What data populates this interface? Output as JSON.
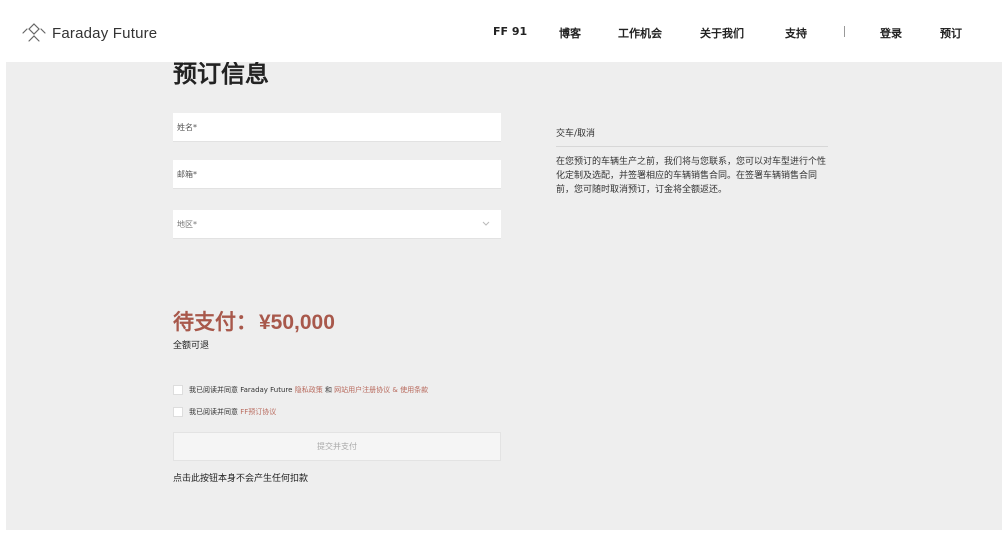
{
  "header": {
    "brand": "Faraday Future",
    "nav": {
      "ff91": "FF 91",
      "blog": "博客",
      "jobs": "工作机会",
      "about": "关于我们",
      "support": "支持",
      "login": "登录",
      "reserve": "预订"
    }
  },
  "form": {
    "title": "预订信息",
    "name_placeholder": "姓名*",
    "email_placeholder": "邮箱*",
    "region_label": "地区*"
  },
  "side": {
    "heading": "交车/取消",
    "body": "在您预订的车辆生产之前，我们将与您联系，您可以对车型进行个性化定制及选配，并签署相应的车辆销售合同。在签署车辆销售合同前，您可随时取消预订，订金将全额返还。"
  },
  "payment": {
    "label": "待支付：",
    "amount": "¥50,000",
    "refund_note": "全额可退"
  },
  "agreements": {
    "line1_prefix": "我已阅读并同意 Faraday Future",
    "line1_privacy": "隐私政策",
    "line1_and": "和",
    "line1_terms": "网站用户注册协议 & 使用条款",
    "line2_prefix": "我已阅读并同意",
    "line2_link": "FF预订协议"
  },
  "submit_label": "提交并支付",
  "bottom_note": "点击此按钮本身不会产生任何扣款",
  "colors": {
    "accent": "#a8584b",
    "link": "#b86a5d",
    "background": "#eeeeee"
  }
}
